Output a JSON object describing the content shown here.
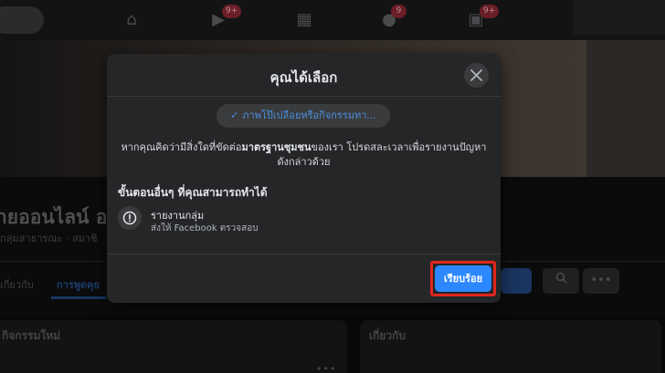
{
  "nav": {
    "badges": [
      "9+",
      "9",
      "9+"
    ],
    "icons": [
      "home-icon",
      "watch-icon",
      "marketplace-icon",
      "groups-icon",
      "gaming-icon"
    ]
  },
  "background": {
    "group_title": "ายออนไลน์ อ",
    "group_sub": "กลุ่มสาธารณะ · สมาชิ",
    "tab_about": "เกี่ยวกับ",
    "tab_discussion": "การพูดคุย",
    "card_left_label": "กิจกรรมใหม่",
    "card_right_label": "เกี่ยวกับ",
    "more_dots": "•••"
  },
  "modal": {
    "title": "คุณได้เลือก",
    "chip_check": "✓",
    "chip_label": "ภาพโป๊เปลือยหรือกิจกรรมทา...",
    "desc_part1": "หากคุณคิดว่ามีสิ่งใดที่ขัดต่อ",
    "desc_bold": "มาตรฐานชุมชน",
    "desc_part2": "ของเรา โปรดสละเวลาเพื่อรายงานปัญหาดังกล่าวด้วย",
    "section_title": "ขั้นตอนอื่นๆ ที่คุณสามารถทำได้",
    "option_title": "รายงานกลุ่ม",
    "option_sub": "ส่งให้ Facebook ตรวจสอบ",
    "done_label": "เรียบร้อย"
  },
  "colors": {
    "accent": "#2d88ff",
    "highlight": "#e3261d",
    "modal_bg": "#252627"
  }
}
